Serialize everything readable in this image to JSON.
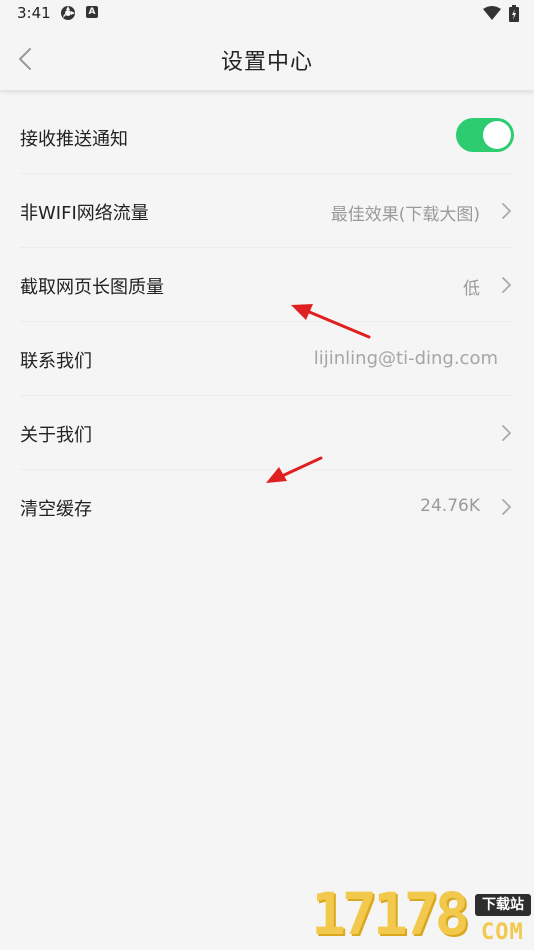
{
  "status_bar": {
    "time": "3:41",
    "icons": [
      "pin-icon",
      "a-icon",
      "wifi-icon",
      "battery-icon"
    ],
    "a_icon_letter": "A"
  },
  "header": {
    "title": "设置中心",
    "back_icon": "chevron-left-icon"
  },
  "settings": {
    "items": [
      {
        "label": "接收推送通知",
        "control": "toggle",
        "toggle_on": true
      },
      {
        "label": "非WIFI网络流量",
        "value": "最佳效果(下载大图)",
        "chevron": true
      },
      {
        "label": "截取网页长图质量",
        "value": "低",
        "chevron": true
      },
      {
        "label": "联系我们",
        "value": "lijinling@ti-ding.com",
        "chevron": false
      },
      {
        "label": "关于我们",
        "value": "",
        "chevron": true
      },
      {
        "label": "清空缓存",
        "value": "24.76K",
        "chevron": true
      }
    ]
  },
  "watermark": {
    "digits": "17178",
    "badge": "下载站",
    "suffix": "COM"
  },
  "colors": {
    "background": "#f5f5f5",
    "toggle_on": "#2ecc71",
    "annotation_arrow": "#e02020",
    "value_text": "#9a9a9a"
  }
}
